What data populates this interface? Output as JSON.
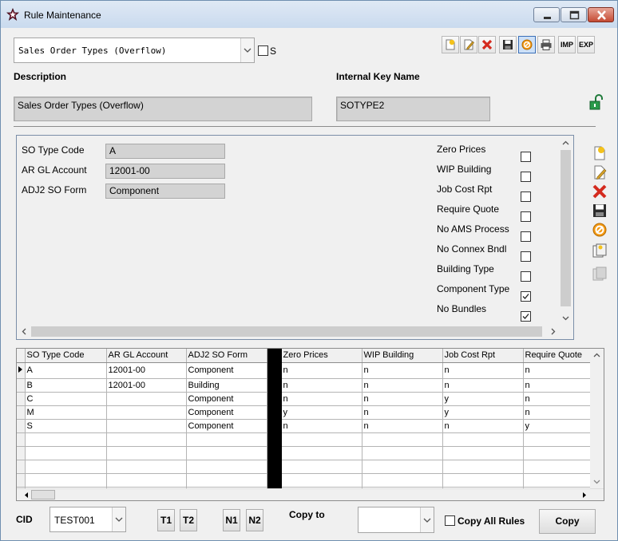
{
  "window": {
    "title": "Rule Maintenance"
  },
  "rule_select": {
    "value": "Sales Order Types (Overflow)",
    "s_label": "S",
    "s_checked": false
  },
  "toolbar": {
    "imp_label": "IMP",
    "exp_label": "EXP"
  },
  "header": {
    "description_label": "Description",
    "description_value": "Sales Order Types (Overflow)",
    "internal_key_label": "Internal Key Name",
    "internal_key_value": "SOTYPE2"
  },
  "form": {
    "fields": [
      {
        "label": "SO Type Code",
        "value": "A"
      },
      {
        "label": "AR GL Account",
        "value": "12001-00"
      },
      {
        "label": "ADJ2 SO Form",
        "value": "Component"
      }
    ],
    "flags": [
      {
        "label": "Zero Prices",
        "checked": false
      },
      {
        "label": "WIP Building",
        "checked": false
      },
      {
        "label": "Job Cost Rpt",
        "checked": false
      },
      {
        "label": "Require Quote",
        "checked": false
      },
      {
        "label": "No AMS Process",
        "checked": false
      },
      {
        "label": "No Connex Bndl",
        "checked": false
      },
      {
        "label": "Building Type",
        "checked": false
      },
      {
        "label": "Component Type",
        "checked": true
      },
      {
        "label": "No Bundles",
        "checked": true
      }
    ]
  },
  "grid": {
    "columns": [
      "SO Type Code",
      "AR GL Account",
      "ADJ2 SO Form",
      "Zero Prices",
      "WIP Building",
      "Job Cost Rpt",
      "Require Quote"
    ],
    "rows": [
      [
        "A",
        "12001-00",
        "Component",
        "n",
        "n",
        "n",
        "n"
      ],
      [
        "B",
        "12001-00",
        "Building",
        "n",
        "n",
        "n",
        "n"
      ],
      [
        "C",
        "",
        "Component",
        "n",
        "n",
        "y",
        "n"
      ],
      [
        "M",
        "",
        "Component",
        "y",
        "n",
        "y",
        "n"
      ],
      [
        "S",
        "",
        "Component",
        "n",
        "n",
        "n",
        "y"
      ]
    ],
    "empty_rows": 5
  },
  "footer": {
    "cid_label": "CID",
    "cid_value": "TEST001",
    "t1": "T1",
    "t2": "T2",
    "n1": "N1",
    "n2": "N2",
    "copy_to_label": "Copy to",
    "copy_to_value": "",
    "copy_all_label": "Copy All Rules",
    "copy_button": "Copy"
  }
}
